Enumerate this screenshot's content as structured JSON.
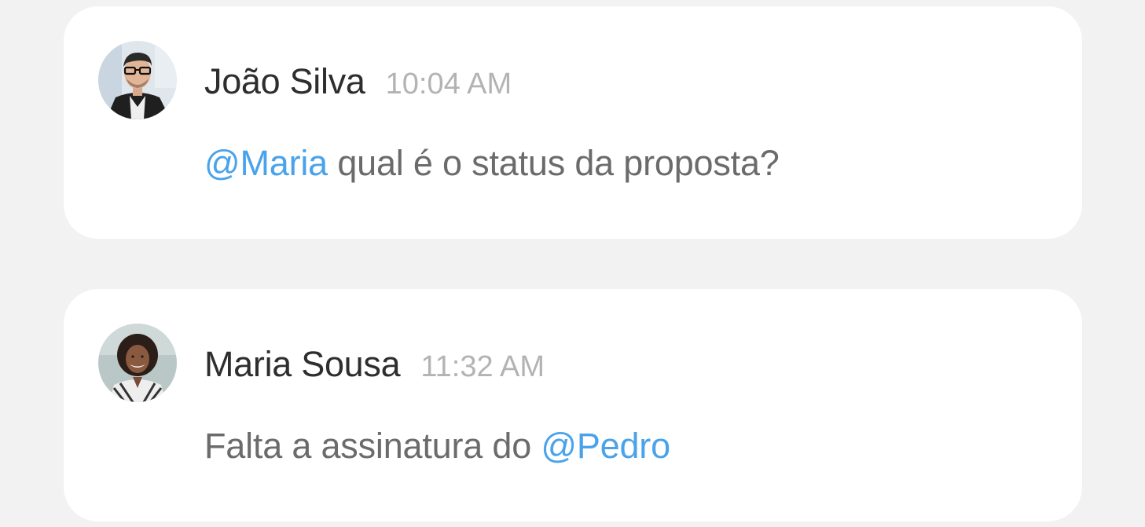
{
  "colors": {
    "background": "#f2f2f2",
    "card": "#ffffff",
    "author": "#2e2e2e",
    "timestamp": "#b3b3b3",
    "message_text": "#6b6b6b",
    "mention": "#4aa3ea"
  },
  "messages": [
    {
      "author": "João Silva",
      "time": "10:04 AM",
      "avatar_icon": "user-avatar-photo",
      "body": {
        "mention": "@Maria",
        "text": " qual é o status da proposta?"
      }
    },
    {
      "author": "Maria Sousa",
      "time": "11:32 AM",
      "avatar_icon": "user-avatar-photo",
      "body": {
        "text": "Falta a assinatura do ",
        "mention": "@Pedro"
      }
    }
  ]
}
